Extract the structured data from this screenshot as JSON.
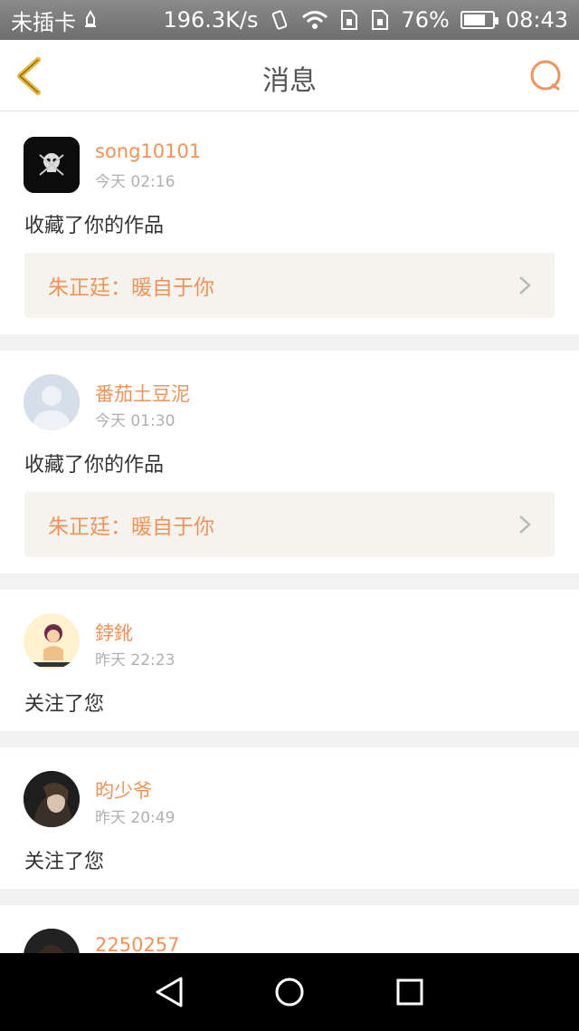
{
  "status_bar": {
    "carrier": "未插卡",
    "speed": "196.3K/s",
    "battery_percent": "76%",
    "battery_level": 0.76,
    "time": "08:43"
  },
  "header": {
    "title": "消息"
  },
  "messages": [
    {
      "username": "song10101",
      "time": "今天 02:16",
      "action": "收藏了你的作品",
      "work": "朱正廷：暖自于你"
    },
    {
      "username": "番茄土豆泥",
      "time": "今天 01:30",
      "action": "收藏了你的作品",
      "work": "朱正廷：暖自于你"
    },
    {
      "username": "鋍鈋",
      "time": "昨天 22:23",
      "action": "关注了您"
    },
    {
      "username": "昀少爷",
      "time": "昨天 20:49",
      "action": "关注了您"
    },
    {
      "username": "2250257"
    }
  ],
  "colors": {
    "accent": "#f0935a",
    "back_icon": "#e8b53a"
  }
}
